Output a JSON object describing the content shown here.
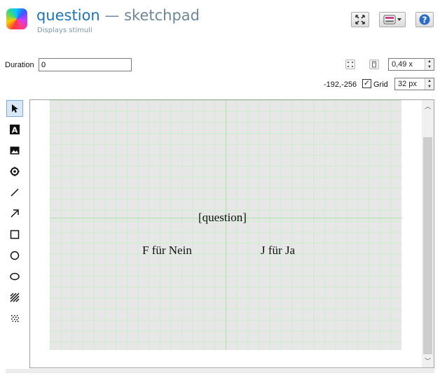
{
  "header": {
    "title_name": "question",
    "title_separator": " — ",
    "title_type": "sketchpad",
    "subtitle": "Displays stimuli"
  },
  "header_buttons": [
    "maximize-icon",
    "view-options-icon",
    "help-icon"
  ],
  "toolbar": {
    "duration_label": "Duration",
    "duration_value": "0",
    "zoom_value": "0,49 x",
    "cursor_position": "-192,-256",
    "grid_label": "Grid",
    "grid_checked": true,
    "grid_size": "32 px"
  },
  "tools": [
    "pointer",
    "text",
    "image",
    "fixdot",
    "line",
    "arrow",
    "rectangle",
    "circle",
    "ellipse",
    "gabor",
    "noise"
  ],
  "canvas": {
    "background_color": "#e7e7e7",
    "grid_color": "#cdeccd",
    "items": {
      "question": "[question]",
      "left_option": "F für Nein",
      "right_option": "J für Ja"
    }
  }
}
